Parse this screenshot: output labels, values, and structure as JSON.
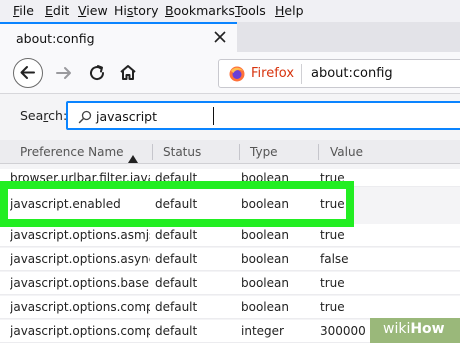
{
  "menubar": {
    "items": [
      {
        "accel": "F",
        "rest": "ile"
      },
      {
        "accel": "E",
        "rest": "dit"
      },
      {
        "accel": "V",
        "rest": "iew"
      },
      {
        "accel": "",
        "pre": "Hi",
        "accel2": "s",
        "rest": "tory"
      },
      {
        "accel": "B",
        "rest": "ookmarks"
      },
      {
        "accel": "T",
        "rest": "ools"
      },
      {
        "accel": "H",
        "rest": "elp"
      }
    ]
  },
  "tab": {
    "title": "about:config"
  },
  "navbar": {
    "identity_label": "Firefox",
    "url": "about:config"
  },
  "search": {
    "label_accel": "r",
    "label_pre": "Sea",
    "label_post": "ch:",
    "value": "javascript"
  },
  "table": {
    "columns": [
      "Preference Name",
      "Status",
      "Type",
      "Value"
    ],
    "rows": [
      {
        "name": "browser.urlbar.filter.java...",
        "status": "default",
        "type": "boolean",
        "value": "true"
      },
      {
        "name": "javascript.enabled",
        "status": "default",
        "type": "boolean",
        "value": "true"
      },
      {
        "name": "javascript.options.asmjs",
        "status": "default",
        "type": "boolean",
        "value": "true"
      },
      {
        "name": "javascript.options.asyncs...",
        "status": "default",
        "type": "boolean",
        "value": "false"
      },
      {
        "name": "javascript.options.baseli...",
        "status": "default",
        "type": "boolean",
        "value": "true"
      },
      {
        "name": "javascript.options.compa...",
        "status": "default",
        "type": "boolean",
        "value": "true"
      },
      {
        "name": "javascript.options.compa...",
        "status": "default",
        "type": "integer",
        "value": "300000"
      }
    ]
  },
  "watermark": {
    "prefix": "wiki",
    "suffix": "How"
  },
  "colors": {
    "accent": "#0a84ff",
    "highlight": "#22ee22",
    "firefox_label": "#d7330d"
  }
}
